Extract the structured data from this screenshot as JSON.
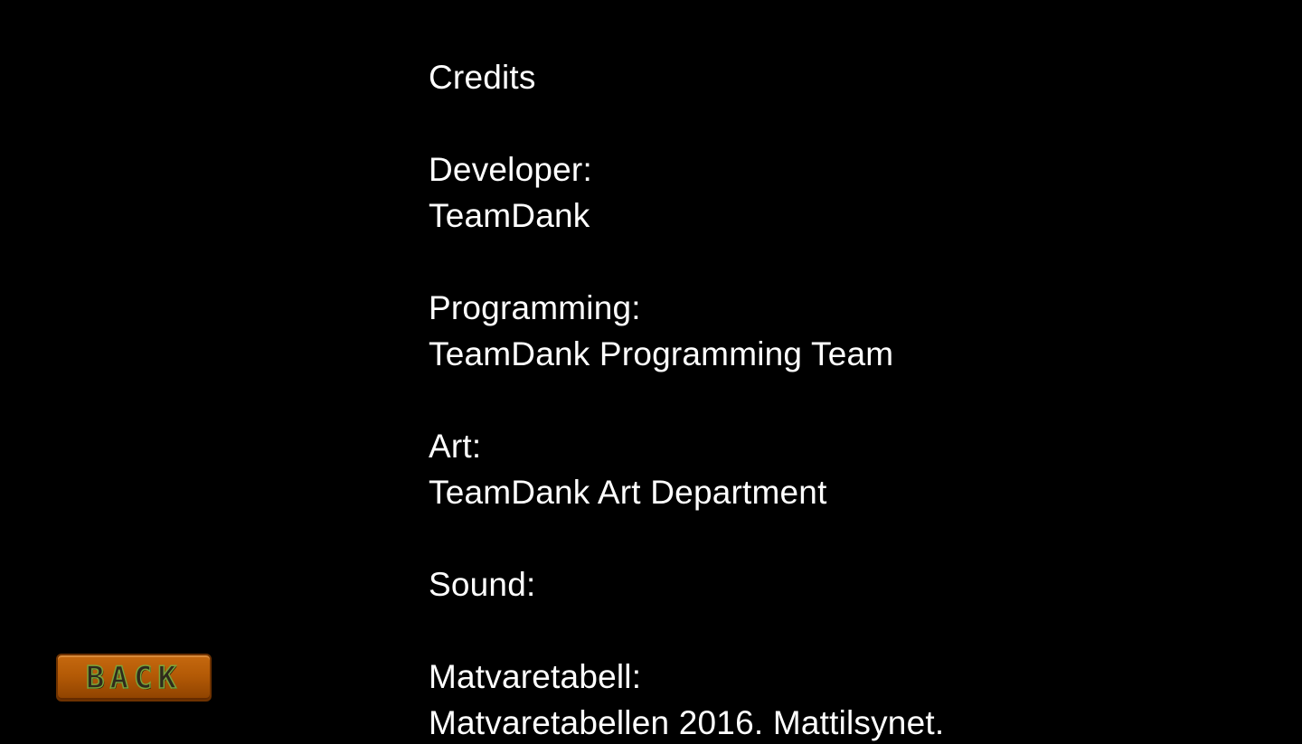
{
  "credits": {
    "title": "Credits",
    "developer_heading": "Developer:",
    "developer_name": "TeamDank",
    "programming_heading": "Programming:",
    "programming_name": "TeamDank Programming Team",
    "art_heading": "Art:",
    "art_name": "TeamDank Art Department",
    "sound_heading": "Sound:",
    "matvaretabell_heading": "Matvaretabell:",
    "matvaretabell_source": "Matvaretabellen 2016. Mattilsynet."
  },
  "back_button": {
    "label": "BACK",
    "color": "#b45a06"
  }
}
